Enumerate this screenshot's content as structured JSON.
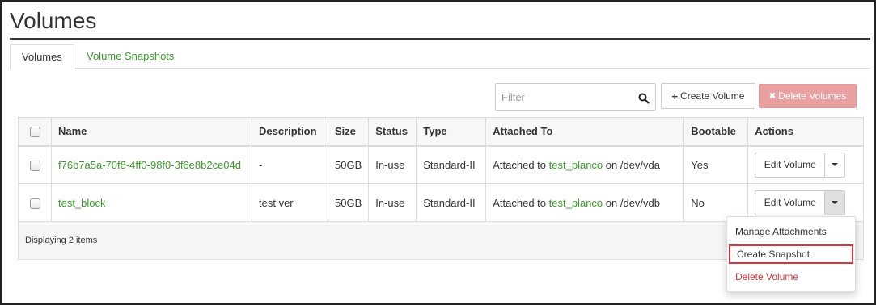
{
  "page": {
    "title": "Volumes"
  },
  "tabs": [
    {
      "label": "Volumes",
      "active": true
    },
    {
      "label": "Volume Snapshots",
      "active": false
    }
  ],
  "toolbar": {
    "filter_placeholder": "Filter",
    "create_label": "Create Volume",
    "create_glyph": "+",
    "delete_label": "Delete Volumes",
    "delete_glyph": "✖"
  },
  "table": {
    "columns": [
      "Name",
      "Description",
      "Size",
      "Status",
      "Type",
      "Attached To",
      "Bootable",
      "Actions"
    ],
    "rows": [
      {
        "name": "f76b7a5a-70f8-4ff0-98f0-3f6e8b2ce04d",
        "description": "-",
        "size": "50GB",
        "status": "In-use",
        "type": "Standard-II",
        "attached_prefix": "Attached to",
        "attached_instance": "test_planco",
        "attached_suffix": "on /dev/vda",
        "bootable": "Yes",
        "action_label": "Edit Volume"
      },
      {
        "name": "test_block",
        "description": "test ver",
        "size": "50GB",
        "status": "In-use",
        "type": "Standard-II",
        "attached_prefix": "Attached to",
        "attached_instance": "test_planco",
        "attached_suffix": "on /dev/vdb",
        "bootable": "No",
        "action_label": "Edit Volume"
      }
    ],
    "footer": "Displaying 2 items"
  },
  "dropdown_menu": {
    "items": [
      "Manage Attachments",
      "Create Snapshot",
      "Delete Volume"
    ]
  },
  "colors": {
    "link": "#3a9a2b",
    "danger": "#d9363e",
    "delete_button_bg": "#e8a0a0"
  },
  "icons": {
    "search": "search-icon",
    "caret": "chevron-down-icon"
  }
}
